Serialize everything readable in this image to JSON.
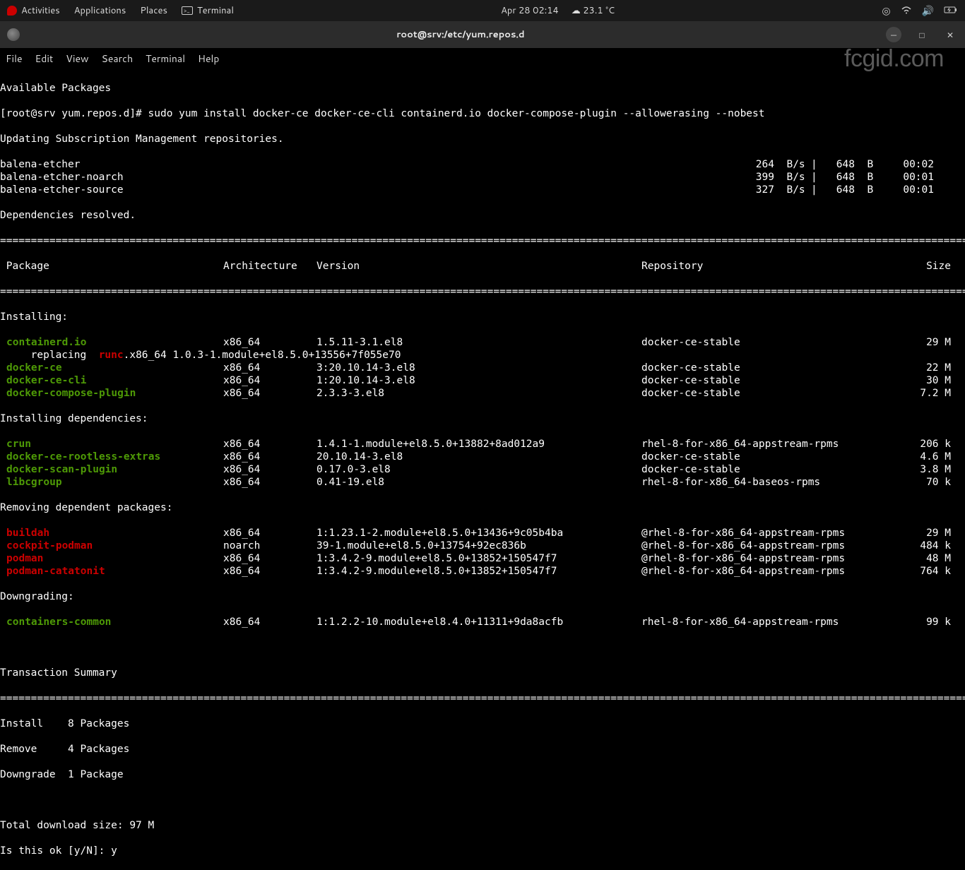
{
  "topbar": {
    "activities": "Activities",
    "applications": "Applications",
    "places": "Places",
    "app_label": "Terminal",
    "datetime": "Apr 28  02:14",
    "temp": "23.1 °C"
  },
  "titlebar": {
    "title": "root@srv:/etc/yum.repos.d"
  },
  "menubar": {
    "file": "File",
    "edit": "Edit",
    "view": "View",
    "search": "Search",
    "terminal": "Terminal",
    "help": "Help"
  },
  "watermark": "fcgid.com",
  "term": {
    "line_available": "Available Packages",
    "prompt": "[root@srv yum.repos.d]# ",
    "cmd": "sudo yum install docker-ce docker-ce-cli containerd.io docker-compose-plugin --allowerasing --nobest",
    "updating": "Updating Subscription Management repositories.",
    "downloads": [
      {
        "name": "balena-etcher",
        "speed": "264",
        "unit": "B/s",
        "size": "648",
        "sizeu": "B",
        "time": "00:02"
      },
      {
        "name": "balena-etcher-noarch",
        "speed": "399",
        "unit": "B/s",
        "size": "648",
        "sizeu": "B",
        "time": "00:01"
      },
      {
        "name": "balena-etcher-source",
        "speed": "327",
        "unit": "B/s",
        "size": "648",
        "sizeu": "B",
        "time": "00:01"
      }
    ],
    "deps_resolved": "Dependencies resolved.",
    "hr": "========================================================================================================================================================================================",
    "headers": {
      "pkg": " Package",
      "arch": "Architecture",
      "ver": "Version",
      "repo": "Repository",
      "size": "Size"
    },
    "sec_installing": "Installing:",
    "installing": [
      {
        "name": "containerd.io",
        "arch": "x86_64",
        "ver": "1.5.11-3.1.el8",
        "repo": "docker-ce-stable",
        "size": "29 M"
      },
      {
        "name": "docker-ce",
        "arch": "x86_64",
        "ver": "3:20.10.14-3.el8",
        "repo": "docker-ce-stable",
        "size": "22 M"
      },
      {
        "name": "docker-ce-cli",
        "arch": "x86_64",
        "ver": "1:20.10.14-3.el8",
        "repo": "docker-ce-stable",
        "size": "30 M"
      },
      {
        "name": "docker-compose-plugin",
        "arch": "x86_64",
        "ver": "2.3.3-3.el8",
        "repo": "docker-ce-stable",
        "size": "7.2 M"
      }
    ],
    "replacing_prefix": "     replacing  ",
    "replacing_pkg": "runc",
    "replacing_rest": ".x86_64 1.0.3-1.module+el8.5.0+13556+7f055e70",
    "sec_deps": "Installing dependencies:",
    "deps": [
      {
        "name": "crun",
        "arch": "x86_64",
        "ver": "1.4.1-1.module+el8.5.0+13882+8ad012a9",
        "repo": "rhel-8-for-x86_64-appstream-rpms",
        "size": "206 k"
      },
      {
        "name": "docker-ce-rootless-extras",
        "arch": "x86_64",
        "ver": "20.10.14-3.el8",
        "repo": "docker-ce-stable",
        "size": "4.6 M"
      },
      {
        "name": "docker-scan-plugin",
        "arch": "x86_64",
        "ver": "0.17.0-3.el8",
        "repo": "docker-ce-stable",
        "size": "3.8 M"
      },
      {
        "name": "libcgroup",
        "arch": "x86_64",
        "ver": "0.41-19.el8",
        "repo": "rhel-8-for-x86_64-baseos-rpms",
        "size": "70 k"
      }
    ],
    "sec_removing": "Removing dependent packages:",
    "removing": [
      {
        "name": "buildah",
        "arch": "x86_64",
        "ver": "1:1.23.1-2.module+el8.5.0+13436+9c05b4ba",
        "repo": "@rhel-8-for-x86_64-appstream-rpms",
        "size": "29 M"
      },
      {
        "name": "cockpit-podman",
        "arch": "noarch",
        "ver": "39-1.module+el8.5.0+13754+92ec836b",
        "repo": "@rhel-8-for-x86_64-appstream-rpms",
        "size": "484 k"
      },
      {
        "name": "podman",
        "arch": "x86_64",
        "ver": "1:3.4.2-9.module+el8.5.0+13852+150547f7",
        "repo": "@rhel-8-for-x86_64-appstream-rpms",
        "size": "48 M"
      },
      {
        "name": "podman-catatonit",
        "arch": "x86_64",
        "ver": "1:3.4.2-9.module+el8.5.0+13852+150547f7",
        "repo": "@rhel-8-for-x86_64-appstream-rpms",
        "size": "764 k"
      }
    ],
    "sec_down": "Downgrading:",
    "downgrading": [
      {
        "name": "containers-common",
        "arch": "x86_64",
        "ver": "1:1.2.2-10.module+el8.4.0+11311+9da8acfb",
        "repo": "rhel-8-for-x86_64-appstream-rpms",
        "size": "99 k"
      }
    ],
    "tx_summary": "Transaction Summary",
    "sum_install": "Install    8 Packages",
    "sum_remove": "Remove     4 Packages",
    "sum_down": "Downgrade  1 Package",
    "total_dl": "Total download size: 97 M",
    "confirm": "Is this ok [y/N]: y"
  }
}
